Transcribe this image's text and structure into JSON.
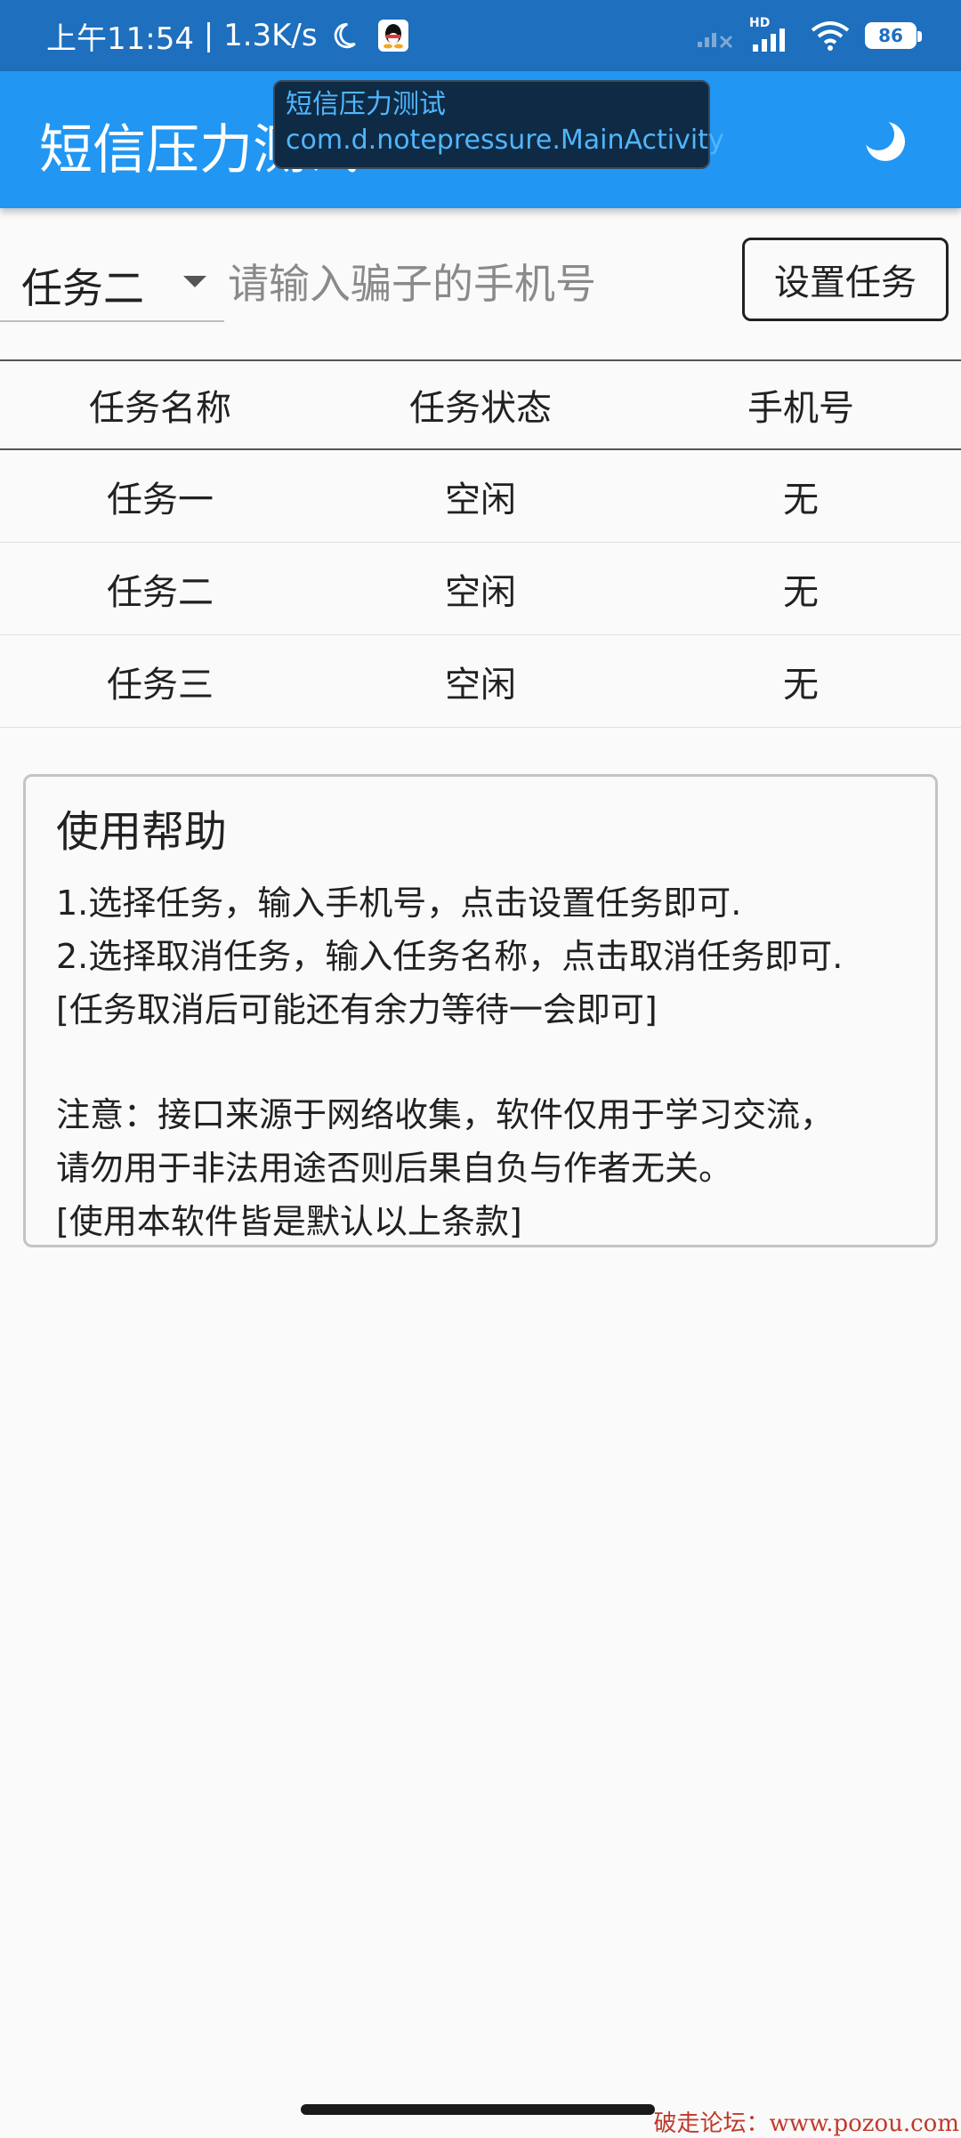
{
  "status_bar": {
    "time": "上午11:54",
    "net_speed": "1.3K/s",
    "signal_label": "HD",
    "battery": "86"
  },
  "app_bar": {
    "title": "短信压力测试"
  },
  "overlay": {
    "app_name": "短信压力测试",
    "activity": "com.d.notepressure.MainActivity"
  },
  "task_form": {
    "selected_task": "任务二",
    "phone_placeholder": "请输入骗子的手机号",
    "phone_value": "",
    "set_button": "设置任务"
  },
  "table": {
    "headers": [
      "任务名称",
      "任务状态",
      "手机号"
    ],
    "rows": [
      [
        "任务一",
        "空闲",
        "无"
      ],
      [
        "任务二",
        "空闲",
        "无"
      ],
      [
        "任务三",
        "空闲",
        "无"
      ]
    ]
  },
  "help": {
    "title": "使用帮助",
    "lines": [
      "1.选择任务，输入手机号，点击设置任务即可.",
      "2.选择取消任务，输入任务名称，点击取消任务即可.",
      "[任务取消后可能还有余力等待一会即可]",
      "注意：接口来源于网络收集，软件仅用于学习交流，",
      "请勿用于非法用途否则后果自负与作者无关。",
      "[使用本软件皆是默认以上条款]"
    ]
  },
  "watermark": "破走论坛：www.pozou.com",
  "colors": {
    "status_bar": "#1e6fbd",
    "app_bar": "#2196f3",
    "overlay_bg": "#0f2a44",
    "overlay_text": "#4fb6ff",
    "watermark": "#c0392b"
  }
}
